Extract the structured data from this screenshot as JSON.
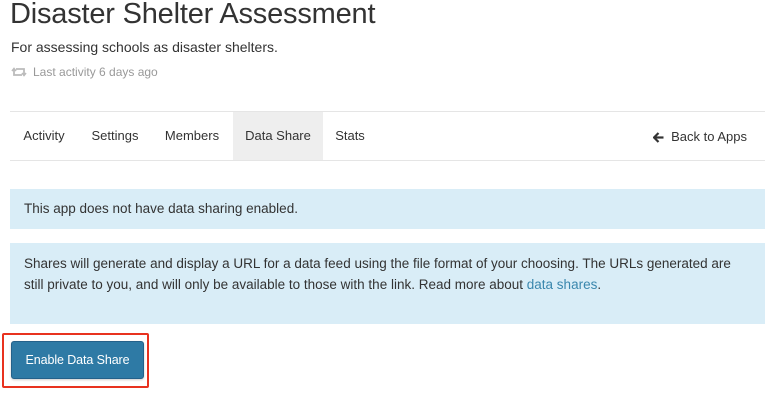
{
  "header": {
    "title": "Disaster Shelter Assessment",
    "subtitle": "For assessing schools as disaster shelters.",
    "activity_icon": "retweet-icon",
    "activity_text": "Last activity 6 days ago"
  },
  "tabs": {
    "items": [
      {
        "label": "Activity",
        "active": false
      },
      {
        "label": "Settings",
        "active": false
      },
      {
        "label": "Members",
        "active": false
      },
      {
        "label": "Data Share",
        "active": true
      },
      {
        "label": "Stats",
        "active": false
      }
    ],
    "back_icon": "arrow-left-icon",
    "back_label": "Back to Apps"
  },
  "alerts": {
    "status": "This app does not have data sharing enabled.",
    "info_text": "Shares will generate and display a URL for a data feed using the file format of your choosing. The URLs generated are still private to you, and will only be available to those with the link. Read more about ",
    "info_link": "data shares",
    "info_end": "."
  },
  "actions": {
    "enable_label": "Enable Data Share"
  },
  "colors": {
    "alert_bg": "#d9edf7",
    "link": "#3a87ad",
    "button": "#2e7aa5",
    "highlight": "#e8321f",
    "active_tab": "#eeeeee"
  }
}
